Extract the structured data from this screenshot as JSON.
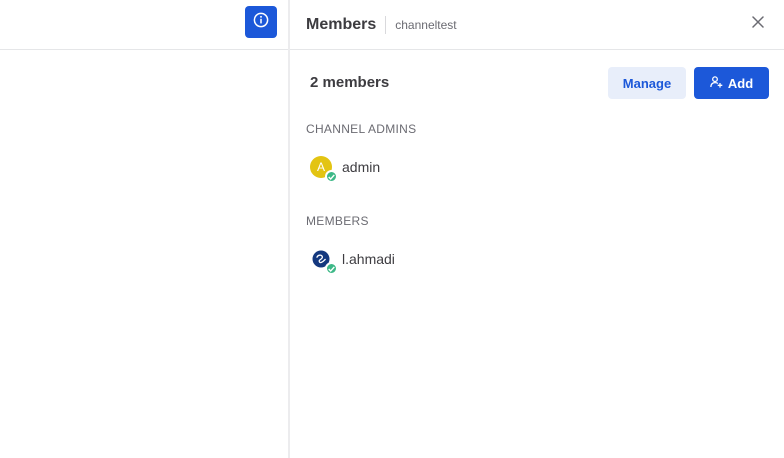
{
  "rhs": {
    "title": "Members",
    "channel": "channeltest",
    "member_count": "2 members",
    "manage_label": "Manage",
    "add_label": "Add"
  },
  "sections": {
    "admins_title": "CHANNEL ADMINS",
    "members_title": "MEMBERS"
  },
  "members": [
    {
      "name": "admin",
      "avatar_initial": "A",
      "status": "online"
    },
    {
      "name": "l.ahmadi",
      "avatar_initial": "",
      "status": "online"
    }
  ],
  "colors": {
    "accent": "#1c58d9",
    "online": "#3db887",
    "admin_avatar": "#e3c412"
  },
  "icons": {
    "info": "info-circle-icon",
    "close": "close-icon",
    "add_user": "add-user-icon",
    "status": "check-icon"
  }
}
